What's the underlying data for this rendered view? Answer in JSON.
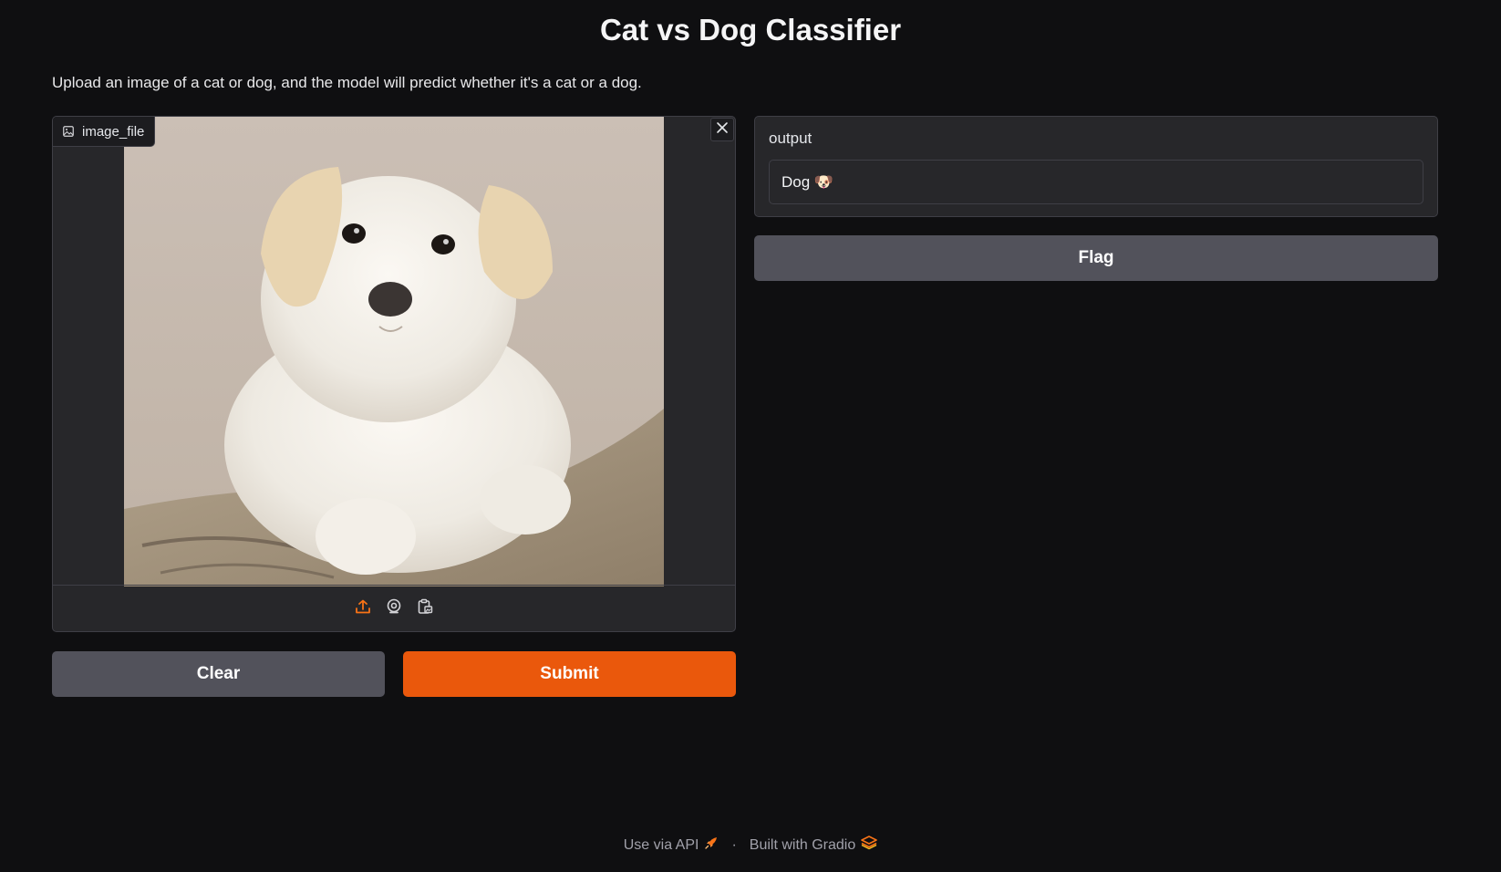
{
  "app": {
    "title": "Cat vs Dog Classifier",
    "description": "Upload an image of a cat or dog, and the model will predict whether it's a cat or a dog."
  },
  "image_input": {
    "label": "image_file",
    "icons": [
      "image-icon",
      "close-icon",
      "upload-icon",
      "webcam-icon",
      "clipboard-icon"
    ]
  },
  "buttons": {
    "clear": "Clear",
    "submit": "Submit",
    "flag": "Flag"
  },
  "output": {
    "label": "output",
    "value": "Dog 🐶"
  },
  "footer": {
    "api_link": "Use via API",
    "separator": "·",
    "built_with": "Built with Gradio"
  },
  "colors": {
    "background": "#0f0f11",
    "panel": "#27272a",
    "accent": "#ea580c",
    "secondary_button": "#52525b"
  }
}
